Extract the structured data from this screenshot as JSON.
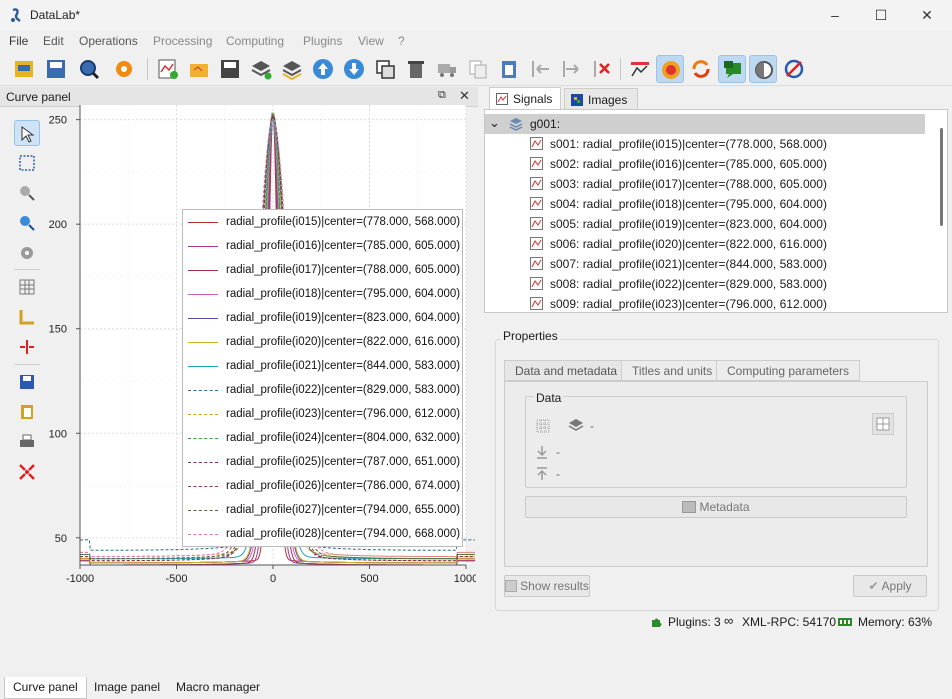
{
  "window": {
    "title": "DataLab*"
  },
  "menu": [
    "File",
    "Edit",
    "Operations",
    "Processing",
    "Computing",
    "Plugins",
    "View",
    "?"
  ],
  "left_panel": {
    "title": "Curve panel",
    "tabs": [
      "Curve panel",
      "Image panel",
      "Macro manager"
    ],
    "selected_tab": "Curve panel"
  },
  "chart_data": {
    "type": "line",
    "x_ticks": [
      "-1000",
      "-500",
      "0",
      "500",
      "1000"
    ],
    "y_ticks": [
      "50",
      "100",
      "150",
      "200",
      "250"
    ],
    "xlim": [
      -1000,
      1000
    ],
    "ylim": [
      37,
      257
    ],
    "grid": true,
    "legend_position": "top-right",
    "series": [
      {
        "name": "radial_profile(i015)|center=(778.000, 568.000)",
        "color": "#b03030",
        "style": "solid",
        "fwhm_x": [
          -60,
          60
        ],
        "base": 38
      },
      {
        "name": "radial_profile(i016)|center=(785.000, 605.000)",
        "color": "#9a3a9a",
        "style": "solid",
        "fwhm_x": [
          -75,
          75
        ],
        "base": 37
      },
      {
        "name": "radial_profile(i017)|center=(788.000, 605.000)",
        "color": "#a03050",
        "style": "solid",
        "fwhm_x": [
          -90,
          90
        ],
        "base": 37
      },
      {
        "name": "radial_profile(i018)|center=(795.000, 604.000)",
        "color": "#c060c0",
        "style": "solid",
        "fwhm_x": [
          -100,
          100
        ],
        "base": 38
      },
      {
        "name": "radial_profile(i019)|center=(823.000, 604.000)",
        "color": "#5a4a9a",
        "style": "solid",
        "fwhm_x": [
          -110,
          110
        ],
        "base": 38
      },
      {
        "name": "radial_profile(i020)|center=(822.000, 616.000)",
        "color": "#d4b020",
        "style": "solid",
        "fwhm_x": [
          -115,
          115
        ],
        "base": 38
      },
      {
        "name": "radial_profile(i021)|center=(844.000, 583.000)",
        "color": "#20a0c0",
        "style": "solid",
        "fwhm_x": [
          -130,
          130
        ],
        "base": 40
      },
      {
        "name": "radial_profile(i022)|center=(829.000, 583.000)",
        "color": "#2a6a8a",
        "style": "dashed",
        "fwhm_x": [
          -140,
          140
        ],
        "base": 44
      },
      {
        "name": "radial_profile(i023)|center=(796.000, 612.000)",
        "color": "#d4a020",
        "style": "dashed",
        "fwhm_x": [
          -150,
          150
        ],
        "base": 41
      },
      {
        "name": "radial_profile(i024)|center=(804.000, 632.000)",
        "color": "#3a9a3a",
        "style": "dashed",
        "fwhm_x": [
          -165,
          165
        ],
        "base": 40
      },
      {
        "name": "radial_profile(i025)|center=(787.000, 651.000)",
        "color": "#7a2a5a",
        "style": "dashed",
        "fwhm_x": [
          -175,
          175
        ],
        "base": 39
      },
      {
        "name": "radial_profile(i026)|center=(786.000, 674.000)",
        "color": "#8a3a3a",
        "style": "dashed",
        "fwhm_x": [
          -185,
          185
        ],
        "base": 39
      },
      {
        "name": "radial_profile(i027)|center=(794.000, 655.000)",
        "color": "#6a5a3a",
        "style": "dashed",
        "fwhm_x": [
          -195,
          195
        ],
        "base": 40
      },
      {
        "name": "radial_profile(i028)|center=(794.000, 668.000)",
        "color": "#e070c0",
        "style": "dashed",
        "fwhm_x": [
          -210,
          210
        ],
        "base": 41
      }
    ]
  },
  "right_panel": {
    "tabs": [
      "Signals",
      "Images"
    ],
    "selected_tab": "Signals",
    "tree": {
      "group": "g001:",
      "items": [
        "s001: radial_profile(i015)|center=(778.000, 568.000)",
        "s002: radial_profile(i016)|center=(785.000, 605.000)",
        "s003: radial_profile(i017)|center=(788.000, 605.000)",
        "s004: radial_profile(i018)|center=(795.000, 604.000)",
        "s005: radial_profile(i019)|center=(823.000, 604.000)",
        "s006: radial_profile(i020)|center=(822.000, 616.000)",
        "s007: radial_profile(i021)|center=(844.000, 583.000)",
        "s008: radial_profile(i022)|center=(829.000, 583.000)",
        "s009: radial_profile(i023)|center=(796.000, 612.000)"
      ]
    },
    "properties": {
      "title": "Properties",
      "tabs": [
        "Data and metadata",
        "Titles and units",
        "Computing parameters"
      ],
      "data_group": "Data",
      "values": [
        "-",
        "-",
        "-"
      ],
      "metadata_button": "Metadata",
      "show_results": "Show results",
      "apply": "Apply"
    }
  },
  "status": {
    "plugins": "Plugins: 3",
    "xmlrpc": "XML-RPC: 54170",
    "memory": "Memory: 63%"
  },
  "colors": {
    "accent": "#bcd9f1",
    "group_row": "#cfcfcf"
  }
}
